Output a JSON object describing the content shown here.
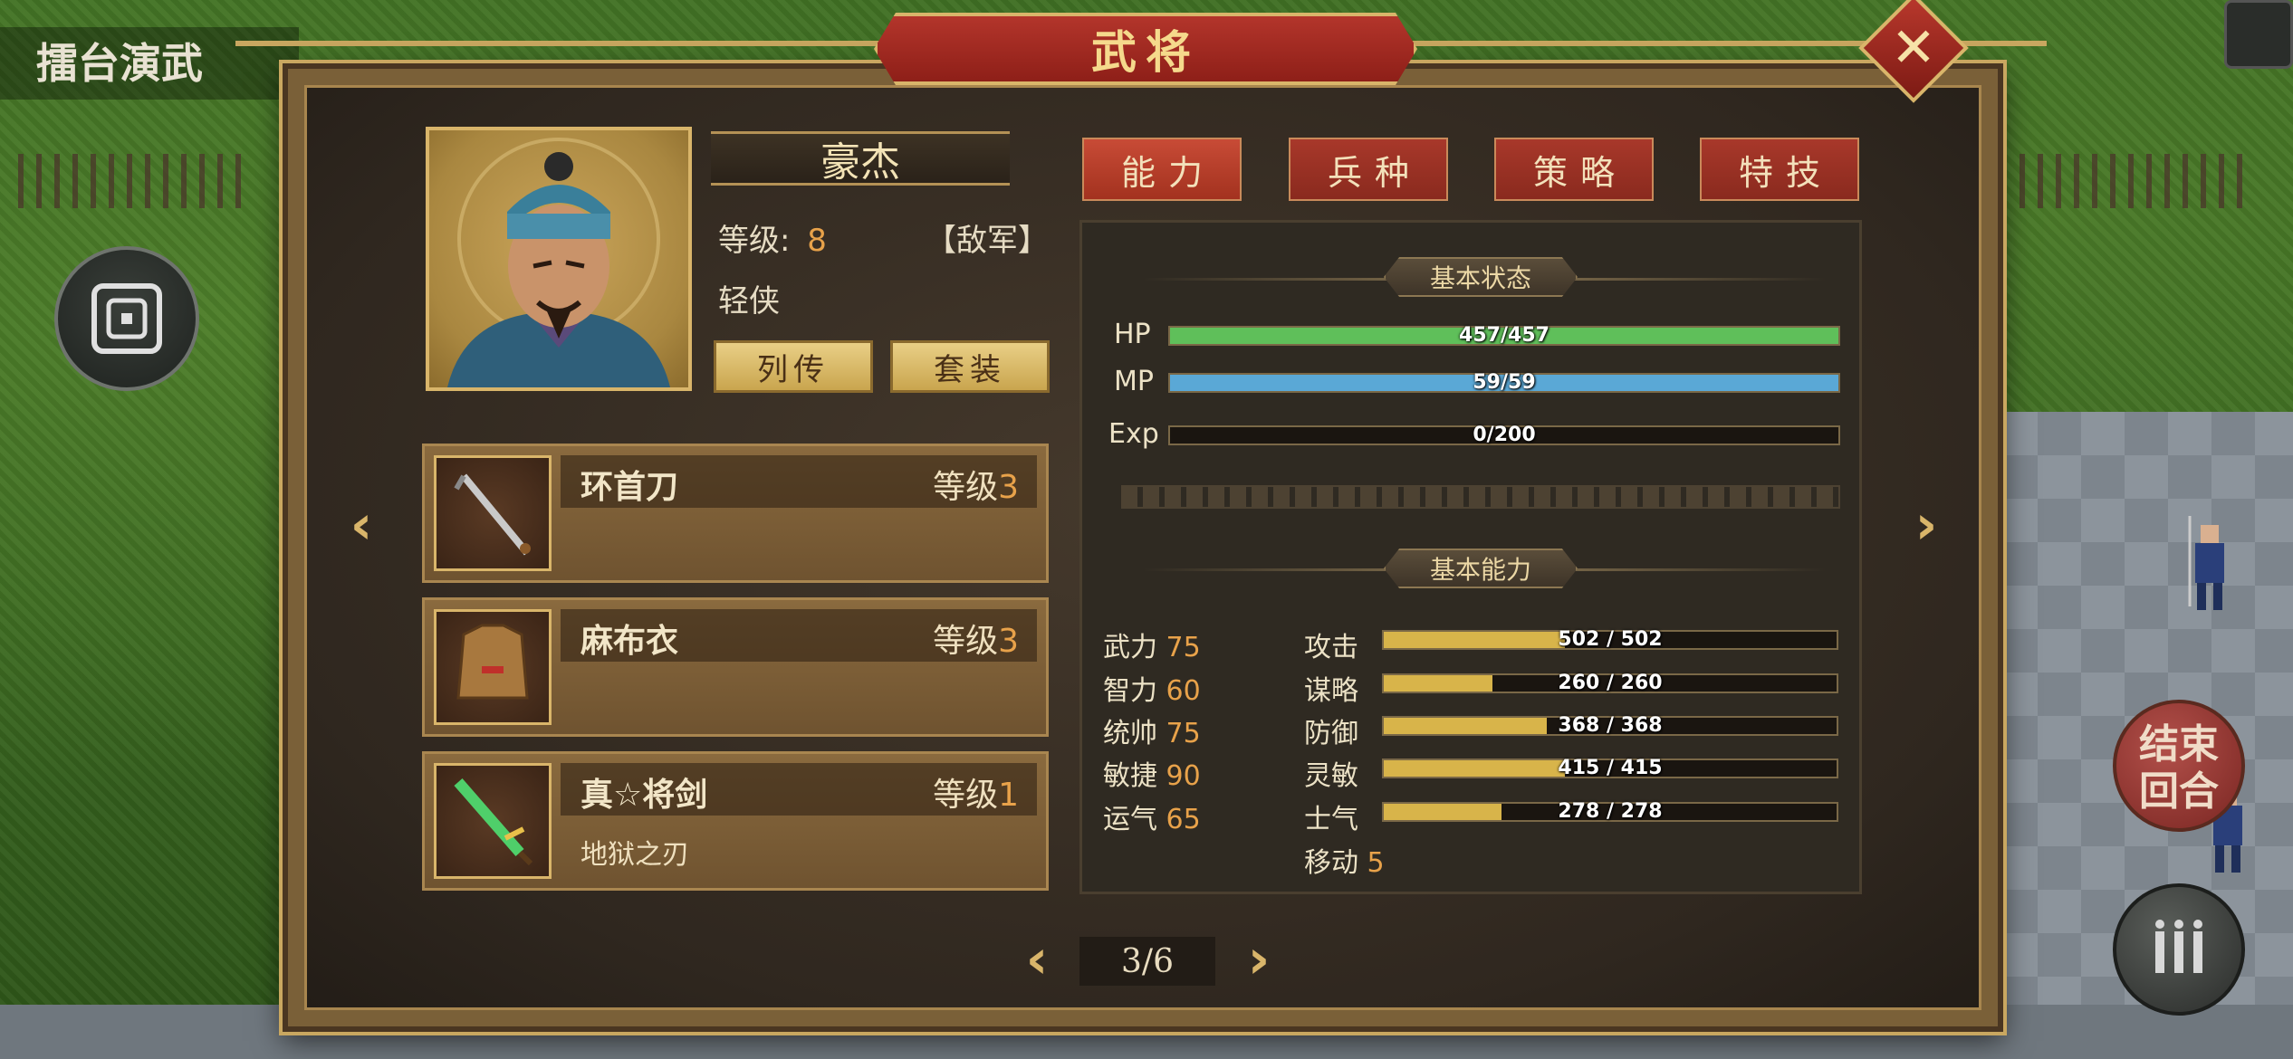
{
  "map": {
    "stage_title": "擂台演武",
    "end_turn_label": "结束\n回合"
  },
  "dialog": {
    "title": "武将",
    "close_label": "✕"
  },
  "hero": {
    "name": "豪杰",
    "level_label": "等级:",
    "level_value": "8",
    "faction": "【敌军】",
    "class": "轻侠",
    "btn_biography": "列传",
    "btn_set": "套装"
  },
  "tabs": [
    {
      "label": "能力",
      "active": true
    },
    {
      "label": "兵种",
      "active": false
    },
    {
      "label": "策略",
      "active": false
    },
    {
      "label": "特技",
      "active": false
    }
  ],
  "equipment": [
    {
      "name": "环首刀",
      "level_label": "等级",
      "level": "3",
      "sub": "",
      "icon": "sword-icon"
    },
    {
      "name": "麻布衣",
      "level_label": "等级",
      "level": "3",
      "sub": "",
      "icon": "armor-icon"
    },
    {
      "name": "真☆将剑",
      "level_label": "等级",
      "level": "1",
      "sub": "地狱之刃",
      "icon": "green-sword-icon"
    }
  ],
  "status": {
    "section_title": "基本状态",
    "bars": [
      {
        "label": "HP",
        "text": "457/457",
        "fraction": 1.0,
        "color": "#5fbf5a"
      },
      {
        "label": "MP",
        "text": "59/59",
        "fraction": 1.0,
        "color": "#5aa8d6"
      },
      {
        "label": "Exp",
        "text": "0/200",
        "fraction": 0.0,
        "color": "#d8b44a"
      }
    ]
  },
  "abilities": {
    "section_title": "基本能力",
    "base": [
      {
        "name": "武力",
        "value": "75"
      },
      {
        "name": "智力",
        "value": "60"
      },
      {
        "name": "统帅",
        "value": "75"
      },
      {
        "name": "敏捷",
        "value": "90"
      },
      {
        "name": "运气",
        "value": "65"
      }
    ],
    "derived": [
      {
        "name": "攻击",
        "text": "502 / 502",
        "fraction": 0.4
      },
      {
        "name": "谋略",
        "text": "260 / 260",
        "fraction": 0.24
      },
      {
        "name": "防御",
        "text": "368 / 368",
        "fraction": 0.36
      },
      {
        "name": "灵敏",
        "text": "415 / 415",
        "fraction": 0.4
      },
      {
        "name": "士气",
        "text": "278 / 278",
        "fraction": 0.26
      }
    ],
    "move_label": "移动",
    "move_value": "5"
  },
  "pagination": {
    "text": "3/6"
  },
  "colors": {
    "bar_gold": "#d8b44a"
  }
}
